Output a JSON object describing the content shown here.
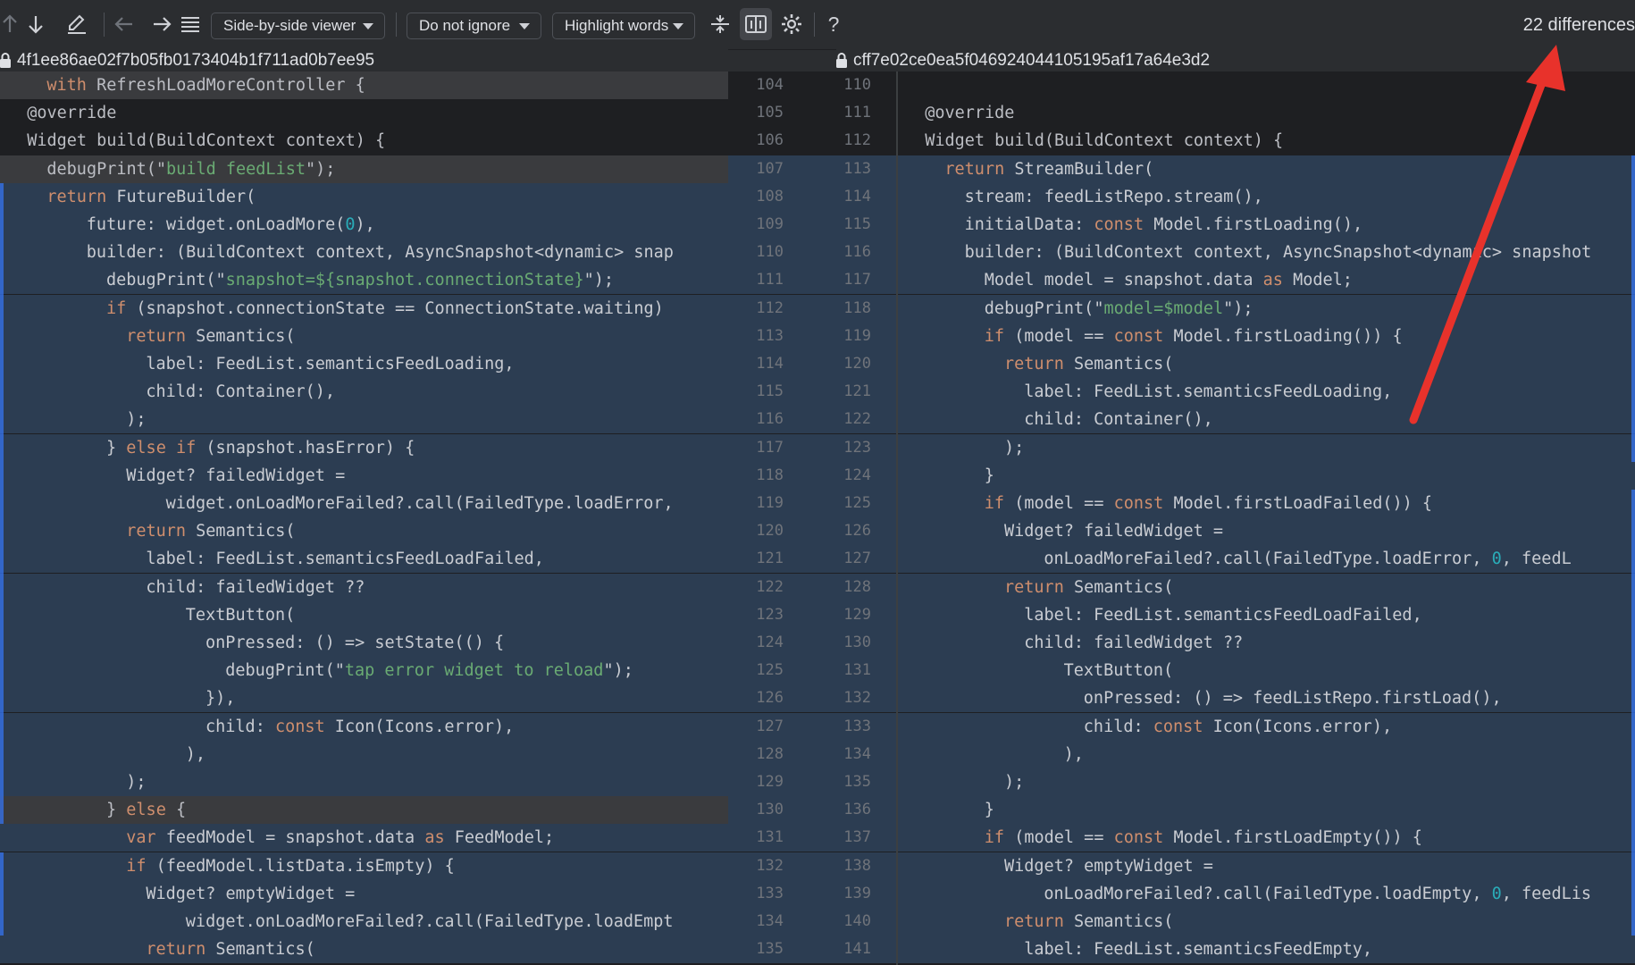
{
  "toolbar": {
    "viewer_label": "Side-by-side viewer",
    "ignore_label": "Do not ignore",
    "highlight_label": "Highlight words",
    "help_label": "?",
    "diff_count": "22 differences"
  },
  "icons": [
    "arrow-up-icon",
    "arrow-down-icon",
    "edit-icon",
    "arrow-left-icon",
    "arrow-right-icon",
    "list-icon",
    "collapse-unchanged-icon",
    "sync-scroll-icon",
    "gear-icon",
    "help-icon",
    "lock-icon"
  ],
  "colors": {
    "bg": "#1e1f22",
    "changed": "#2c3d52",
    "word_highlight": "#35567d",
    "keyword": "#cf8e6d",
    "string": "#6aab73",
    "annotation_arrow": "#e8322b"
  },
  "left": {
    "revision": "4f1ee86ae02f7b05fb0173404b1f711ad0b7ee95",
    "lines": [
      {
        "t": "with RefreshLoadMoreController {",
        "h": "del",
        "ind": 2
      },
      {
        "t": "@override",
        "h": "",
        "ind": 1
      },
      {
        "t": "Widget build(BuildContext context) {",
        "h": "",
        "ind": 1
      },
      {
        "t": "debugPrint(\"build feedList\");",
        "h": "del",
        "ind": 2
      },
      {
        "t": "return FutureBuilder(",
        "h": "mod",
        "ind": 2
      },
      {
        "t": "future: widget.onLoadMore(0),",
        "h": "mod",
        "ind": 4
      },
      {
        "t": "builder: (BuildContext context, AsyncSnapshot<dynamic> snap",
        "h": "mod",
        "ind": 4
      },
      {
        "t": "debugPrint(\"snapshot=${snapshot.connectionState}\");",
        "h": "mod",
        "ind": 5
      },
      {
        "t": "if (snapshot.connectionState == ConnectionState.waiting)",
        "h": "mod",
        "ind": 5
      },
      {
        "t": "return Semantics(",
        "h": "mod",
        "ind": 6
      },
      {
        "t": "label: FeedList.semanticsFeedLoading,",
        "h": "mod",
        "ind": 7
      },
      {
        "t": "child: Container(),",
        "h": "mod",
        "ind": 7
      },
      {
        "t": ");",
        "h": "mod",
        "ind": 6
      },
      {
        "t": "} else if (snapshot.hasError) {",
        "h": "mod",
        "ind": 5
      },
      {
        "t": "Widget? failedWidget =",
        "h": "mod",
        "ind": 6
      },
      {
        "t": "widget.onLoadMoreFailed?.call(FailedType.loadError,",
        "h": "mod",
        "ind": 8
      },
      {
        "t": "return Semantics(",
        "h": "mod",
        "ind": 6
      },
      {
        "t": "label: FeedList.semanticsFeedLoadFailed,",
        "h": "mod",
        "ind": 7
      },
      {
        "t": "child: failedWidget ??",
        "h": "mod",
        "ind": 7
      },
      {
        "t": "TextButton(",
        "h": "mod",
        "ind": 9
      },
      {
        "t": "onPressed: () => setState(() {",
        "h": "mod",
        "ind": 10
      },
      {
        "t": "debugPrint(\"tap error widget to reload\");",
        "h": "mod",
        "ind": 11
      },
      {
        "t": "}),",
        "h": "mod",
        "ind": 10
      },
      {
        "t": "child: const Icon(Icons.error),",
        "h": "mod",
        "ind": 10
      },
      {
        "t": "),",
        "h": "mod",
        "ind": 9
      },
      {
        "t": ");",
        "h": "mod",
        "ind": 6
      },
      {
        "t": "} else {",
        "h": "del",
        "ind": 5
      },
      {
        "t": "var feedModel = snapshot.data as FeedModel;",
        "h": "mod",
        "ind": 6
      },
      {
        "t": "if (feedModel.listData.isEmpty) {",
        "h": "mod",
        "ind": 6
      },
      {
        "t": "Widget? emptyWidget =",
        "h": "mod",
        "ind": 7
      },
      {
        "t": "widget.onLoadMoreFailed?.call(FailedType.loadEmpt",
        "h": "mod",
        "ind": 9
      },
      {
        "t": "return Semantics(",
        "h": "mod",
        "ind": 7
      }
    ]
  },
  "gutter": {
    "left_numbers": [
      "104",
      "105",
      "106",
      "107",
      "108",
      "109",
      "110",
      "111",
      "112",
      "113",
      "114",
      "115",
      "116",
      "117",
      "118",
      "119",
      "120",
      "121",
      "122",
      "123",
      "124",
      "125",
      "126",
      "127",
      "128",
      "129",
      "130",
      "131",
      "132",
      "133",
      "134",
      "135"
    ],
    "right_numbers": [
      "110",
      "111",
      "112",
      "113",
      "114",
      "115",
      "116",
      "117",
      "118",
      "119",
      "120",
      "121",
      "122",
      "123",
      "124",
      "125",
      "126",
      "127",
      "128",
      "129",
      "130",
      "131",
      "132",
      "133",
      "134",
      "135",
      "136",
      "137",
      "138",
      "139",
      "140",
      "141"
    ]
  },
  "right": {
    "revision": "cff7e02ce0ea5f046924044105195af17a64e3d2",
    "lines": [
      {
        "t": "",
        "h": "",
        "ind": 0
      },
      {
        "t": "@override",
        "h": "",
        "ind": 1
      },
      {
        "t": "Widget build(BuildContext context) {",
        "h": "",
        "ind": 1
      },
      {
        "t": "return StreamBuilder(",
        "h": "mod",
        "ind": 2
      },
      {
        "t": "stream: feedListRepo.stream(),",
        "h": "mod",
        "ind": 3
      },
      {
        "t": "initialData: const Model.firstLoading(),",
        "h": "mod",
        "ind": 3
      },
      {
        "t": "builder: (BuildContext context, AsyncSnapshot<dynamic> snapshot",
        "h": "mod",
        "ind": 3
      },
      {
        "t": "Model model = snapshot.data as Model;",
        "h": "mod",
        "ind": 4
      },
      {
        "t": "debugPrint(\"model=$model\");",
        "h": "mod",
        "ind": 4
      },
      {
        "t": "if (model == const Model.firstLoading()) {",
        "h": "mod",
        "ind": 4
      },
      {
        "t": "return Semantics(",
        "h": "mod",
        "ind": 5
      },
      {
        "t": "label: FeedList.semanticsFeedLoading,",
        "h": "mod",
        "ind": 6
      },
      {
        "t": "child: Container(),",
        "h": "mod",
        "ind": 6
      },
      {
        "t": ");",
        "h": "mod",
        "ind": 5
      },
      {
        "t": "}",
        "h": "mod",
        "ind": 4
      },
      {
        "t": "if (model == const Model.firstLoadFailed()) {",
        "h": "mod",
        "ind": 4
      },
      {
        "t": "Widget? failedWidget =",
        "h": "mod",
        "ind": 5
      },
      {
        "t": "onLoadMoreFailed?.call(FailedType.loadError, 0, feedL",
        "h": "mod",
        "ind": 7
      },
      {
        "t": "return Semantics(",
        "h": "mod",
        "ind": 5
      },
      {
        "t": "label: FeedList.semanticsFeedLoadFailed,",
        "h": "mod",
        "ind": 6
      },
      {
        "t": "child: failedWidget ??",
        "h": "mod",
        "ind": 6
      },
      {
        "t": "TextButton(",
        "h": "mod",
        "ind": 8
      },
      {
        "t": "onPressed: () => feedListRepo.firstLoad(),",
        "h": "mod",
        "ind": 9
      },
      {
        "t": "child: const Icon(Icons.error),",
        "h": "mod",
        "ind": 9
      },
      {
        "t": "),",
        "h": "mod",
        "ind": 8
      },
      {
        "t": ");",
        "h": "mod",
        "ind": 5
      },
      {
        "t": "}",
        "h": "mod",
        "ind": 4
      },
      {
        "t": "if (model == const Model.firstLoadEmpty()) {",
        "h": "mod",
        "ind": 4
      },
      {
        "t": "Widget? emptyWidget =",
        "h": "mod",
        "ind": 5
      },
      {
        "t": "onLoadMoreFailed?.call(FailedType.loadEmpty, 0, feedLis",
        "h": "mod",
        "ind": 7
      },
      {
        "t": "return Semantics(",
        "h": "mod",
        "ind": 5
      },
      {
        "t": "label: FeedList.semanticsFeedEmpty,",
        "h": "mod",
        "ind": 6
      }
    ]
  }
}
